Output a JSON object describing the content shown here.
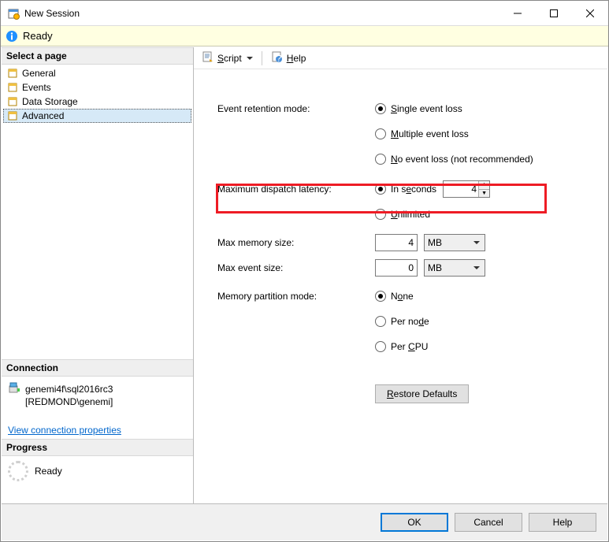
{
  "title": "New Session",
  "status": {
    "text": "Ready"
  },
  "sidebar": {
    "select_page": "Select a page",
    "pages": [
      "General",
      "Events",
      "Data Storage",
      "Advanced"
    ],
    "selected_index": 3,
    "connection_hdr": "Connection",
    "server": "genemi4f\\sql2016rc3",
    "user": "[REDMOND\\genemi]",
    "view_conn": "View connection properties",
    "progress_hdr": "Progress",
    "progress_text": "Ready"
  },
  "toolbar": {
    "script": "Script",
    "help": "Help"
  },
  "form": {
    "retention_label": "Event retention mode:",
    "retention_opts": [
      "Single event loss",
      "Multiple event loss",
      "No event loss (not recommended)"
    ],
    "retention_selected": 0,
    "dispatch_label": "Maximum dispatch latency:",
    "dispatch_opts": [
      "In seconds",
      "Unlimited"
    ],
    "dispatch_selected": 0,
    "dispatch_value": "4",
    "max_mem_label": "Max memory size:",
    "max_mem_value": "4",
    "max_mem_unit": "MB",
    "max_evt_label": "Max event size:",
    "max_evt_value": "0",
    "max_evt_unit": "MB",
    "partition_label": "Memory partition mode:",
    "partition_opts": [
      "None",
      "Per node",
      "Per CPU"
    ],
    "partition_selected": 0,
    "restore_btn": "Restore Defaults"
  },
  "footer": {
    "ok": "OK",
    "cancel": "Cancel",
    "help": "Help"
  }
}
